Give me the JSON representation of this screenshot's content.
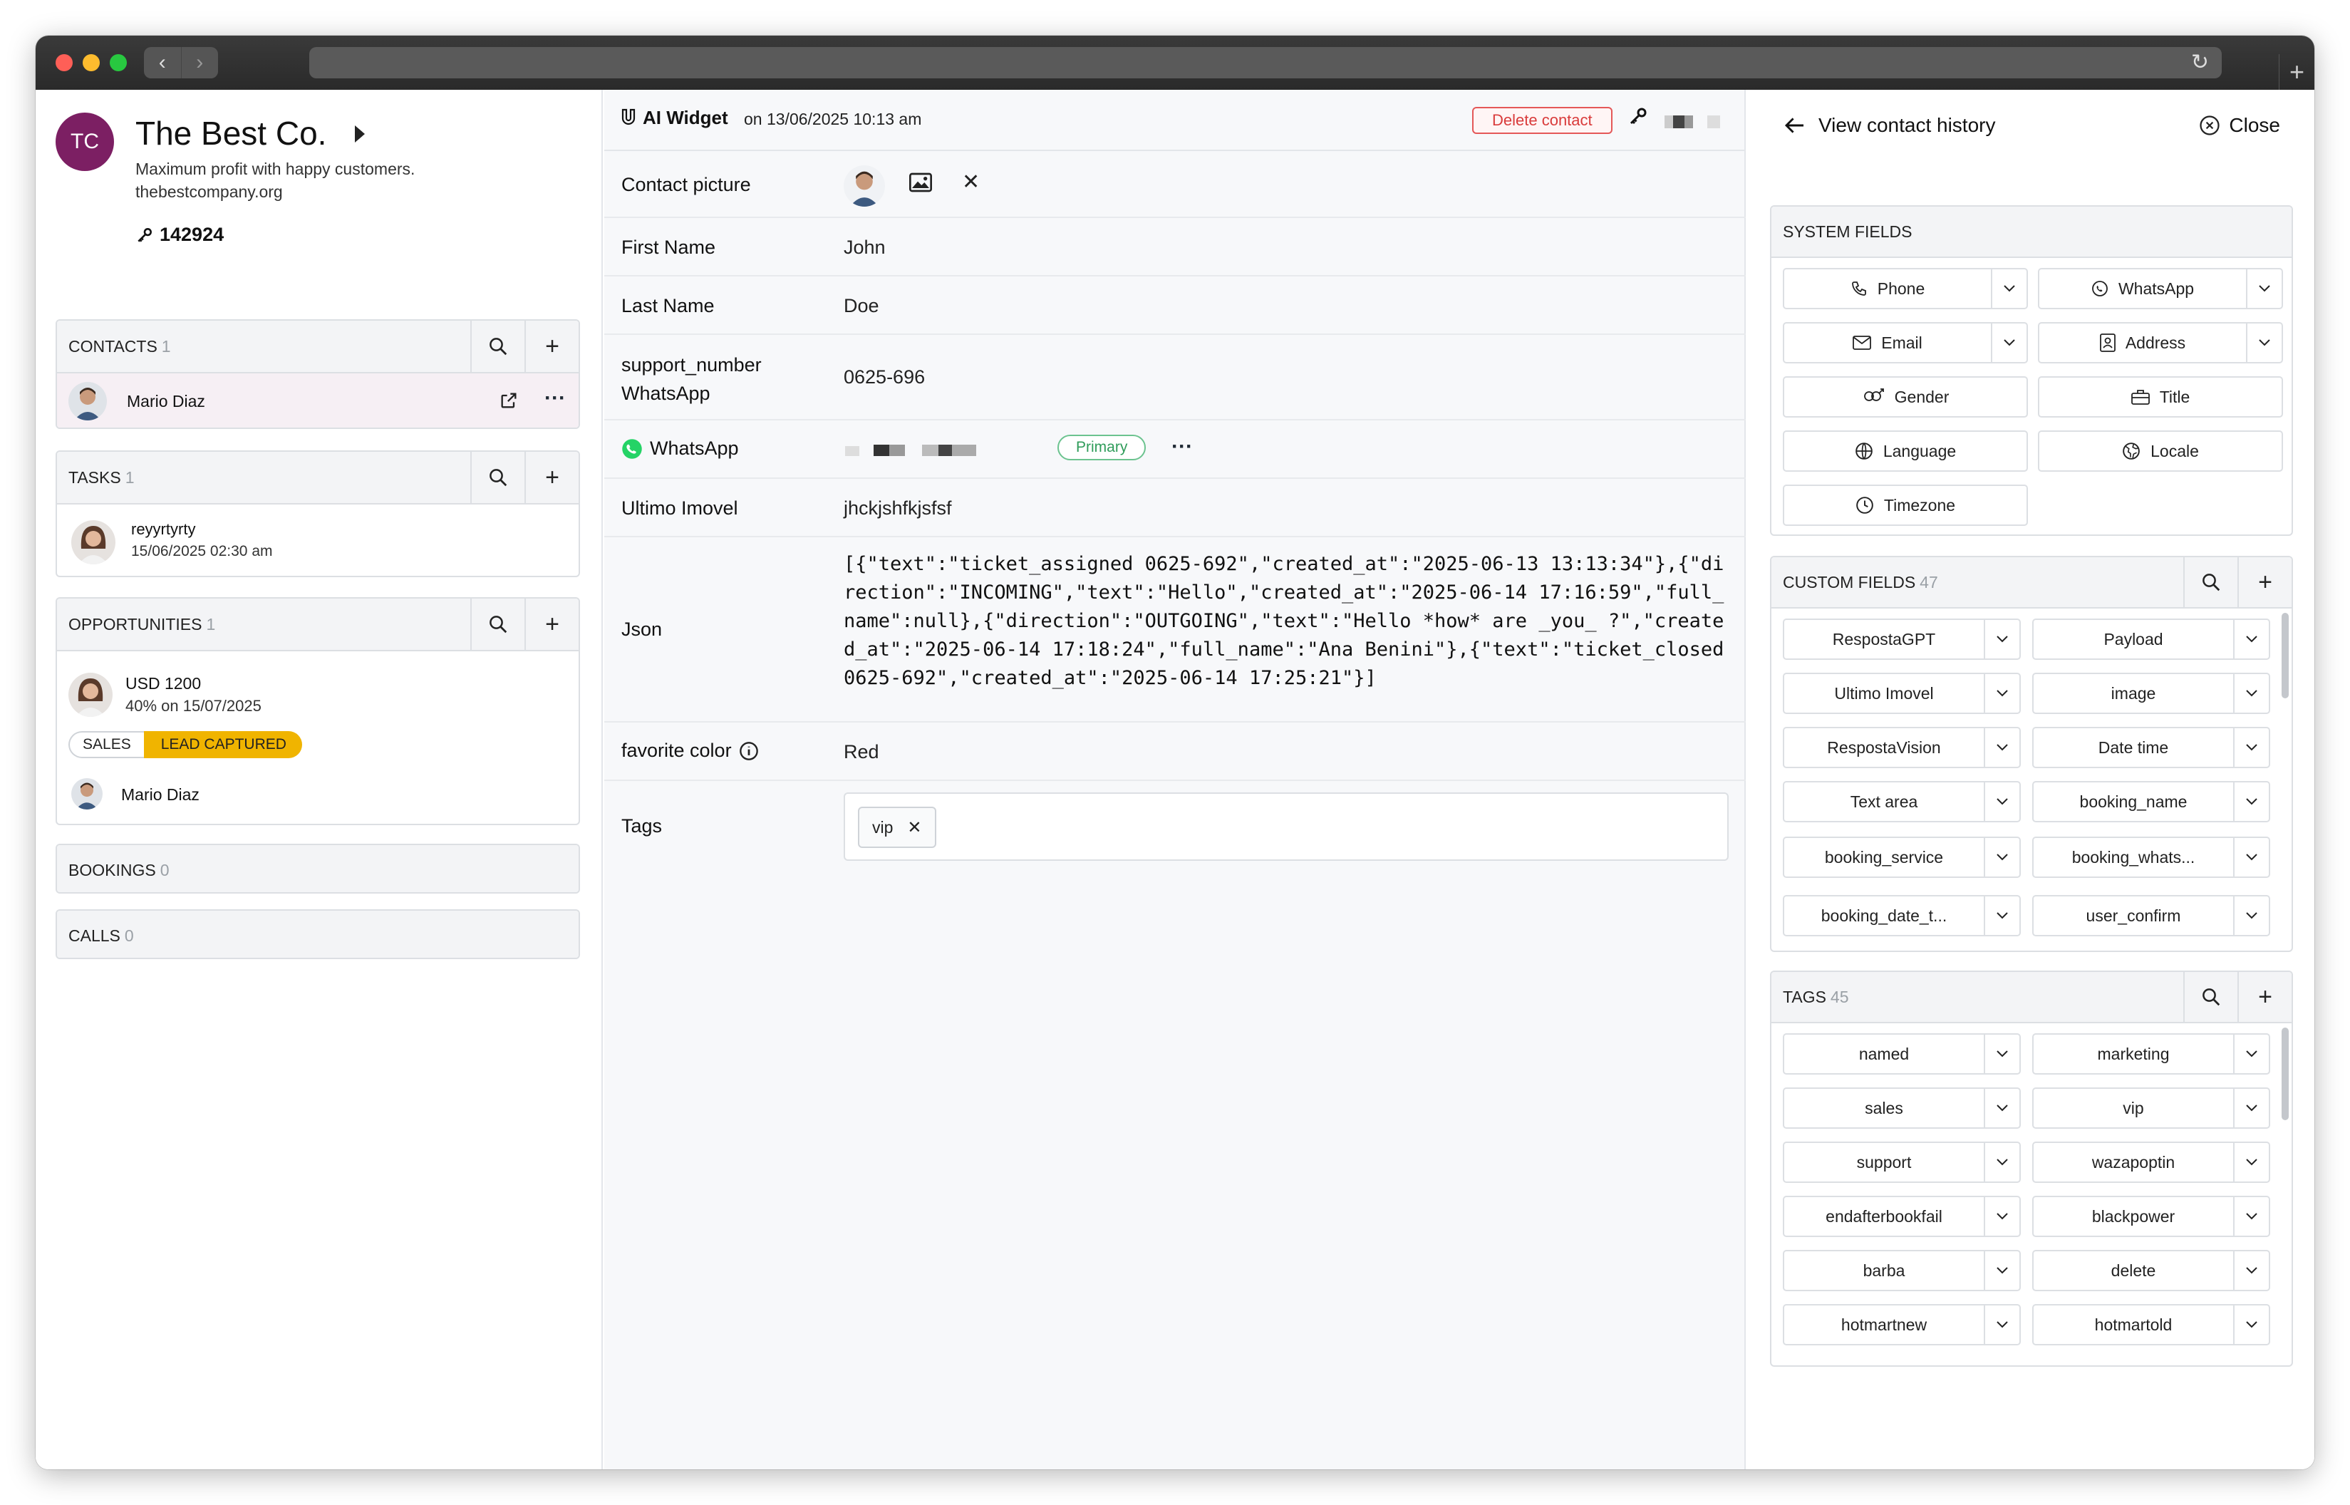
{
  "left": {
    "avatar_initials": "TC",
    "company_name": "The Best Co.",
    "tagline": "Maximum profit with happy customers.",
    "website": "thebestcompany.org",
    "id_number": "142924",
    "contacts": {
      "title": "CONTACTS",
      "count": "1",
      "items": [
        {
          "name": "Mario Diaz"
        }
      ]
    },
    "tasks": {
      "title": "TASKS",
      "count": "1",
      "items": [
        {
          "title": "reyyrtyrty",
          "date": "15/06/2025 02:30 am"
        }
      ]
    },
    "opportunities": {
      "title": "OPPORTUNITIES",
      "count": "1",
      "amount": "USD 1200",
      "probability": "40% on 15/07/2025",
      "pipeline": "SALES",
      "stage": "LEAD CAPTURED",
      "owner": "Mario Diaz"
    },
    "bookings": {
      "title": "BOOKINGS",
      "count": "0"
    },
    "calls": {
      "title": "CALLS",
      "count": "0"
    }
  },
  "middle": {
    "widget_title": "AI Widget",
    "widget_date": "on 13/06/2025 10:13 am",
    "delete_label": "Delete contact",
    "fields": {
      "contact_picture": "Contact picture",
      "first_name_label": "First Name",
      "first_name": "John",
      "last_name_label": "Last Name",
      "last_name": "Doe",
      "support_label_1": "support_number",
      "support_label_2": "WhatsApp",
      "support_value": "0625-696",
      "whatsapp_label": "WhatsApp",
      "whatsapp_badge": "Primary",
      "ultimo_label": "Ultimo Imovel",
      "ultimo_value": "jhckjshfkjsfsf",
      "json_label": "Json",
      "json_value": "[{\"text\":\"ticket_assigned 0625-692\",\"created_at\":\"2025-06-13 13:13:34\"},{\"direction\":\"INCOMING\",\"text\":\"Hello\",\"created_at\":\"2025-06-14 17:16:59\",\"full_name\":null},{\"direction\":\"OUTGOING\",\"text\":\"Hello *how* are _you_ ?\",\"created_at\":\"2025-06-14 17:18:24\",\"full_name\":\"Ana Benini\"},{\"text\":\"ticket_closed 0625-692\",\"created_at\":\"2025-06-14 17:25:21\"}]",
      "fav_label": "favorite color",
      "fav_value": "Red",
      "tags_label": "Tags",
      "tag_value": "vip"
    }
  },
  "right": {
    "history_label": "View contact history",
    "close_label": "Close",
    "system_fields": {
      "title": "SYSTEM FIELDS",
      "items": [
        "Phone",
        "WhatsApp",
        "Email",
        "Address",
        "Gender",
        "Title",
        "Language",
        "Locale",
        "Timezone"
      ]
    },
    "custom_fields": {
      "title": "CUSTOM FIELDS",
      "count": "47",
      "items": [
        "RespostaGPT",
        "Payload",
        "Ultimo Imovel",
        "image",
        "RespostaVision",
        "Date time",
        "Text area",
        "booking_name",
        "booking_service",
        "booking_whats...",
        "booking_date_t...",
        "user_confirm"
      ]
    },
    "tags": {
      "title": "TAGS",
      "count": "45",
      "items": [
        "named",
        "marketing",
        "sales",
        "vip",
        "support",
        "wazapoptin",
        "endafterbookfail",
        "blackpower",
        "barba",
        "delete",
        "hotmartnew",
        "hotmartold"
      ]
    }
  },
  "colors": {
    "avatar": "#7c1f63",
    "stage": "#f0b400",
    "primary": "#2f9c5a",
    "danger": "#d93b3b"
  }
}
